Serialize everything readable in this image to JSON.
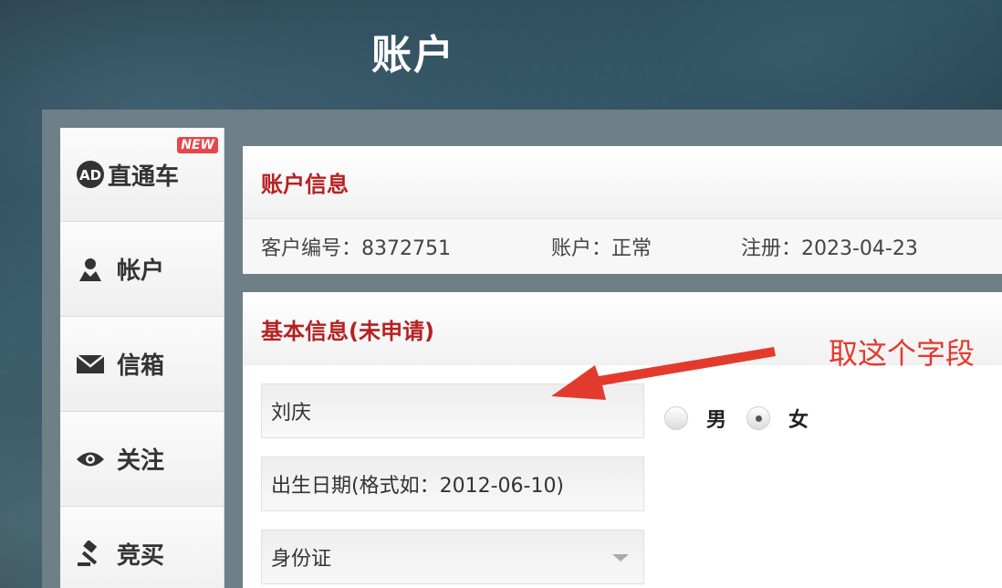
{
  "header": {
    "title": "账户"
  },
  "sidebar": {
    "items": [
      {
        "label": "直通车",
        "icon": "ad-logo-icon",
        "badge": "NEW"
      },
      {
        "label": "帐户",
        "icon": "user-icon"
      },
      {
        "label": "信箱",
        "icon": "envelope-icon"
      },
      {
        "label": "关注",
        "icon": "eye-icon"
      },
      {
        "label": "竞买",
        "icon": "gavel-icon"
      }
    ]
  },
  "account_info": {
    "title": "账户信息",
    "customer_no": "客户编号：8372751",
    "status": "账户：正常",
    "registered": "注册：2023-04-23"
  },
  "basic_info": {
    "title": "基本信息(未申请)",
    "name_value": "刘庆",
    "birth_placeholder": "出生日期(格式如：2012-06-10)",
    "id_type_selected": "身份证",
    "gender_options": [
      "男",
      "女"
    ],
    "gender_selected": "女"
  },
  "annotation": {
    "text": "取这个字段",
    "color": "#e23b2e"
  },
  "colors": {
    "accent_red": "#b52222",
    "badge_red": "#e8474a"
  }
}
